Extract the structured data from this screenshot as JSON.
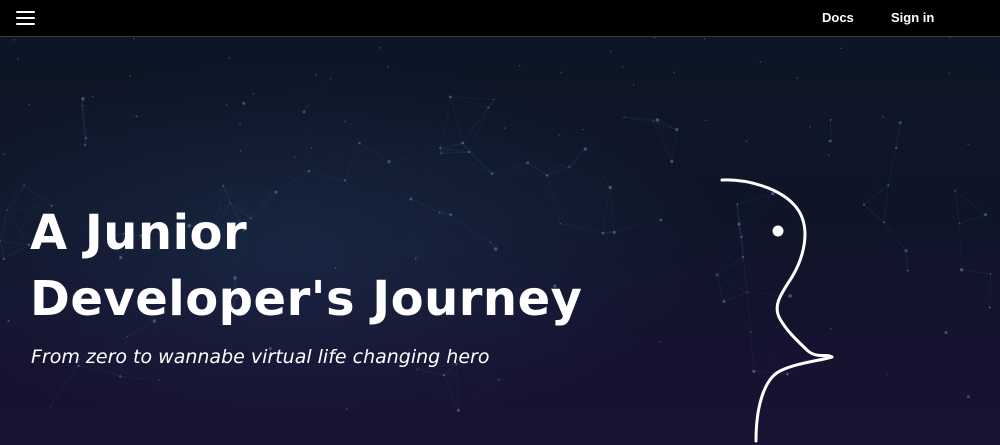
{
  "nav": {
    "docs_label": "Docs",
    "signin_label": "Sign in"
  },
  "hero": {
    "title_line1": "A Junior",
    "title_line2": "Developer's Journey",
    "subtitle": "From zero to wannabe virtual life changing hero"
  },
  "colors": {
    "navbar_bg": "#000000",
    "hero_bg_top": "#0d1626",
    "hero_bg_bottom": "#1a1233",
    "text": "#ffffff",
    "network_lines": "#3b5f8a"
  },
  "icons": {
    "menu": "hamburger-menu-icon",
    "hero_art": "face-profile-line-art"
  }
}
